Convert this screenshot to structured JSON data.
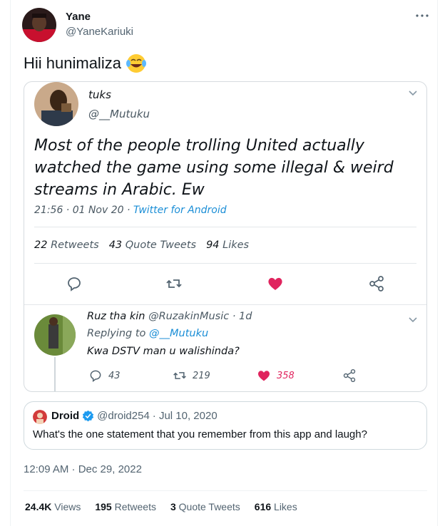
{
  "author": {
    "name": "Yane",
    "handle": "@YaneKariuki"
  },
  "tweet_text": "Hii hunimaliza",
  "icons": {
    "more": "more-dots-icon",
    "emoji": "face-with-tears-of-joy-emoji"
  },
  "screenshot": {
    "name": "tuks",
    "handle": "@__Mutuku",
    "text": "Most of the people trolling United actually watched the game using some illegal & weird streams in Arabic. Ew",
    "time": "21:56 · 01 Nov 20 · ",
    "source": "Twitter for Android",
    "stats": {
      "retweets_count": "22",
      "retweets_label": "Retweets",
      "quotes_count": "43",
      "quotes_label": "Quote Tweets",
      "likes_count": "94",
      "likes_label": "Likes"
    },
    "reply": {
      "name": "Ruz tha kin",
      "meta": " @RuzakinMusic · 1d",
      "replying_prefix": "Replying to ",
      "replying_to": "@__Mutuku",
      "text": "Kwa DSTV man u walishinda?",
      "reply_count": "43",
      "retweet_count": "219",
      "like_count": "358"
    }
  },
  "quoted": {
    "name": "Droid",
    "handle": "@droid254",
    "date": "· Jul 10, 2020",
    "text": "What's the one statement that you remember from this app and laugh?"
  },
  "timestamp": "12:09 AM · Dec 29, 2022",
  "stats": {
    "views_count": "24.4K",
    "views_label": "Views",
    "retweets_count": "195",
    "retweets_label": "Retweets",
    "quotes_count": "3",
    "quotes_label": "Quote Tweets",
    "likes_count": "616",
    "likes_label": "Likes"
  },
  "colors": {
    "like_red": "#e0245e",
    "link_blue": "#1b8ed6",
    "verified_blue": "#1d9bf0"
  }
}
